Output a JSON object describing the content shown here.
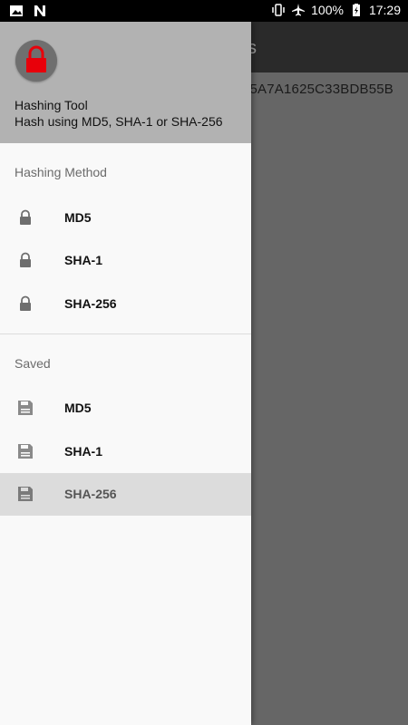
{
  "status_bar": {
    "battery": "100%",
    "time": "17:29",
    "icons": [
      "image-icon",
      "n-icon",
      "vibrate-icon",
      "airplane-icon",
      "battery-charging-icon"
    ]
  },
  "app": {
    "title_partial": "s",
    "hash_value": "5A7A1625C33BDB55B"
  },
  "drawer": {
    "header": {
      "avatar_icon": "lock-icon",
      "title": "Hashing Tool",
      "subtitle": "Hash using MD5, SHA-1 or SHA-256"
    },
    "hashing_method": {
      "label": "Hashing Method",
      "items": [
        {
          "label": "MD5",
          "icon": "lock-icon"
        },
        {
          "label": "SHA-1",
          "icon": "lock-icon"
        },
        {
          "label": "SHA-256",
          "icon": "lock-icon"
        }
      ]
    },
    "saved": {
      "label": "Saved",
      "items": [
        {
          "label": "MD5",
          "icon": "save-icon"
        },
        {
          "label": "SHA-1",
          "icon": "save-icon"
        },
        {
          "label": "SHA-256",
          "icon": "save-icon",
          "selected": true
        }
      ]
    }
  },
  "colors": {
    "lock_accent": "#e8000a",
    "drawer_header": "#b2b2b2",
    "selected_item": "#dcdcdc"
  }
}
